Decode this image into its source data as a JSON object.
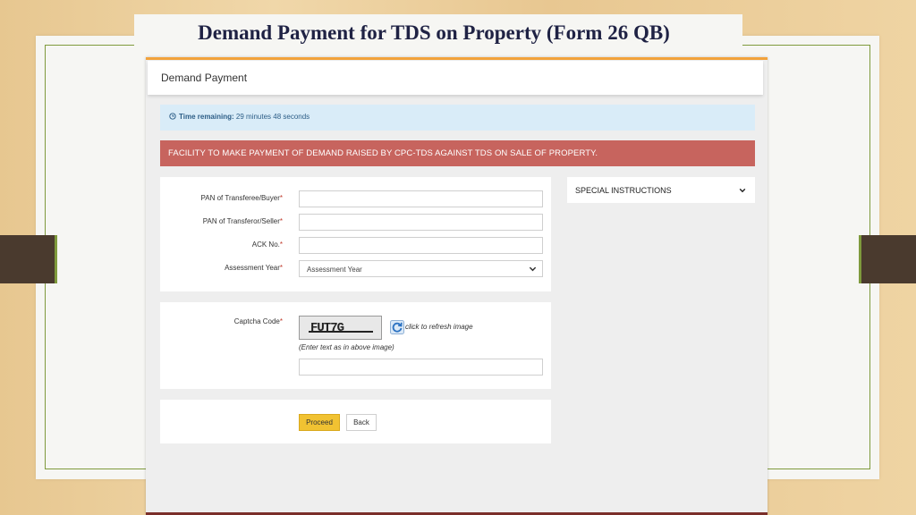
{
  "slide": {
    "title": "Demand Payment for TDS on Property (Form 26 QB)"
  },
  "screenshot": {
    "header_title": "Demand Payment",
    "timer": {
      "label": "Time remaining:",
      "value": "29 minutes 48 seconds"
    },
    "banner": "FACILITY TO MAKE PAYMENT OF DEMAND RAISED BY CPC-TDS AGAINST TDS ON SALE OF PROPERTY.",
    "form": {
      "pan_buyer_label": "PAN of Transferee/Buyer",
      "pan_seller_label": "PAN of Transferor/Seller",
      "ack_label": "ACK No.",
      "ay_label": "Assessment Year",
      "ay_selected": "Assessment Year",
      "required_mark": "*"
    },
    "captcha": {
      "label": "Captcha Code",
      "image_text": "FUT7G",
      "refresh_text": "click to refresh image",
      "hint": "(Enter text as in above image)"
    },
    "buttons": {
      "proceed": "Proceed",
      "back": "Back"
    },
    "special_instructions": "SPECIAL INSTRUCTIONS"
  },
  "colors": {
    "banner": "#c7645e",
    "timer_bg": "#d9ecf8",
    "proceed_button": "#f1c232",
    "top_accent": "#f2a23b",
    "frame_border": "#7f9a3c"
  }
}
